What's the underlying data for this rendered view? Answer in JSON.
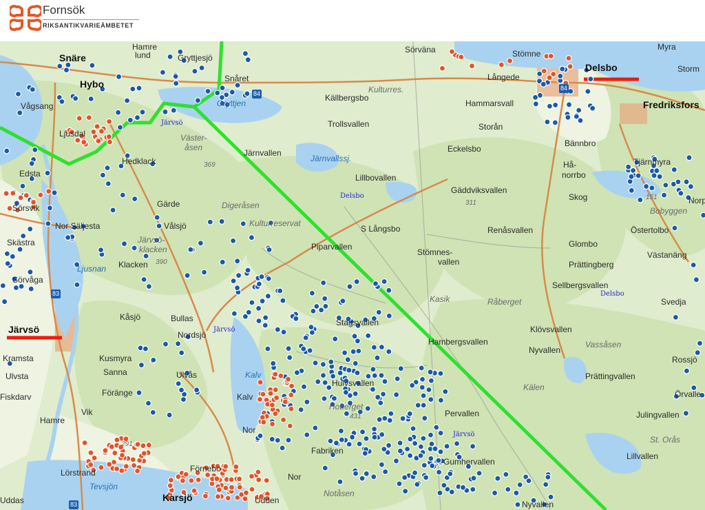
{
  "header": {
    "brand": "Fornsök",
    "subtitle": "RIKSANTIKVARIEÄMBETET",
    "logo_icon": "fornsok-cloverleaf-logo",
    "logo_color": "#e05a2a"
  },
  "colors": {
    "forest": "#cfe3b4",
    "open_land": "#eef3e2",
    "water": "#a9d2f0",
    "road": "#d88a4a",
    "route_line": "#2fe02f",
    "marker_blue": "#1b5aa6",
    "marker_orange": "#e0552a",
    "town": "#e7a77f",
    "highlight": "#ee1c0c"
  },
  "place_labels": [
    {
      "text": "Snäre",
      "cls": "big",
      "id": "snare"
    },
    {
      "text": "Hybo",
      "cls": "big",
      "id": "hybo"
    },
    {
      "text": "Gryttjesjö",
      "cls": "",
      "id": "gryttjesjo"
    },
    {
      "text": "Hamre",
      "cls": "",
      "id": "hamre-n"
    },
    {
      "text": "lund",
      "cls": "",
      "id": "lund"
    },
    {
      "text": "Snåret",
      "cls": "",
      "id": "snaret"
    },
    {
      "text": "Sörväna",
      "cls": "",
      "id": "sorvana"
    },
    {
      "text": "Stömne",
      "cls": "",
      "id": "stomne"
    },
    {
      "text": "Delsbo",
      "cls": "big",
      "id": "delsbo"
    },
    {
      "text": "Myra",
      "cls": "",
      "id": "myra"
    },
    {
      "text": "Storm",
      "cls": "",
      "id": "storm"
    },
    {
      "text": "Långede",
      "cls": "",
      "id": "langede"
    },
    {
      "text": "Fredriksfors",
      "cls": "big",
      "id": "fredriksfors"
    },
    {
      "text": "Vågsang",
      "cls": "",
      "id": "vagsang"
    },
    {
      "text": "Ljusdal",
      "cls": "",
      "id": "ljusdal"
    },
    {
      "text": "Gryttjen",
      "cls": "water",
      "id": "gryttjen"
    },
    {
      "text": "Kulturres.",
      "cls": "hill",
      "id": "kulturres"
    },
    {
      "text": "Källbergsbo",
      "cls": "",
      "id": "kallbergsbo"
    },
    {
      "text": "Hammarsvall",
      "cls": "",
      "id": "hammarsvall"
    },
    {
      "text": "Järvsö",
      "cls": "parish",
      "id": "parish-jarvso-1"
    },
    {
      "text": "Trollsvallen",
      "cls": "",
      "id": "trollsvallen"
    },
    {
      "text": "Storån",
      "cls": "",
      "id": "storan"
    },
    {
      "text": "Väster-",
      "cls": "hill",
      "id": "vaster1"
    },
    {
      "text": "åsen",
      "cls": "hill",
      "id": "vaster2"
    },
    {
      "text": "Järnvallen",
      "cls": "",
      "id": "jarnvallen"
    },
    {
      "text": "Eckelsbo",
      "cls": "",
      "id": "eckelsbo"
    },
    {
      "text": "Bännbro",
      "cls": "",
      "id": "bannbro"
    },
    {
      "text": "Hedklack",
      "cls": "",
      "id": "hedklack"
    },
    {
      "text": "369",
      "cls": "num",
      "id": "n369"
    },
    {
      "text": "Järnvallssj.",
      "cls": "water",
      "id": "jarnvallssj"
    },
    {
      "text": "Hå-",
      "cls": "",
      "id": "hak1"
    },
    {
      "text": "norrbo",
      "cls": "",
      "id": "hak2"
    },
    {
      "text": "Tjärnmyra",
      "cls": "",
      "id": "tjarnmyra"
    },
    {
      "text": "Lillbovallen",
      "cls": "",
      "id": "lillbovallen"
    },
    {
      "text": "Edsta",
      "cls": "",
      "id": "edsta"
    },
    {
      "text": "Gäddviksvallen",
      "cls": "",
      "id": "gaddviksvallen"
    },
    {
      "text": "Skog",
      "cls": "",
      "id": "skog"
    },
    {
      "text": "151",
      "cls": "num",
      "id": "n151"
    },
    {
      "text": "311",
      "cls": "num",
      "id": "n311"
    },
    {
      "text": "Delsbo",
      "cls": "parish",
      "id": "parish-delsbo-1"
    },
    {
      "text": "Bobyggen",
      "cls": "hill",
      "id": "bobyggen"
    },
    {
      "text": "Norp",
      "cls": "",
      "id": "norp"
    },
    {
      "text": "Sörsvik",
      "cls": "",
      "id": "sorsvik"
    },
    {
      "text": "Gärde",
      "cls": "",
      "id": "garde"
    },
    {
      "text": "Digeråsen",
      "cls": "hill",
      "id": "digerasen"
    },
    {
      "text": "Kulturreservat",
      "cls": "hill",
      "id": "kulturreservat"
    },
    {
      "text": "Östertolbo",
      "cls": "",
      "id": "ostertolbo"
    },
    {
      "text": "Nor Säljesta",
      "cls": "",
      "id": "saljesta"
    },
    {
      "text": "Vålsjö",
      "cls": "",
      "id": "valsjo"
    },
    {
      "text": "S Långsbo",
      "cls": "",
      "id": "slangsbo"
    },
    {
      "text": "Renåsvallen",
      "cls": "",
      "id": "renasvallen"
    },
    {
      "text": "Skästra",
      "cls": "",
      "id": "skastra"
    },
    {
      "text": "Järvsö-",
      "cls": "hill",
      "id": "jarvsok1"
    },
    {
      "text": "klacken",
      "cls": "hill",
      "id": "jarvsok2"
    },
    {
      "text": "Glombo",
      "cls": "",
      "id": "glombo"
    },
    {
      "text": "Västanäng",
      "cls": "",
      "id": "vastanang"
    },
    {
      "text": "390",
      "cls": "num",
      "id": "n390"
    },
    {
      "text": "Piparvallen",
      "cls": "",
      "id": "piparvallen"
    },
    {
      "text": "Stömnes-",
      "cls": "",
      "id": "stomnes1"
    },
    {
      "text": "vallen",
      "cls": "",
      "id": "stomnes2"
    },
    {
      "text": "Prättingberg",
      "cls": "",
      "id": "prattingberg"
    },
    {
      "text": "Sörvåga",
      "cls": "",
      "id": "sorvaga"
    },
    {
      "text": "Klacken",
      "cls": "",
      "id": "klacken"
    },
    {
      "text": "Ljusnan",
      "cls": "water",
      "id": "ljusnan"
    },
    {
      "text": "Sellbergsvallen",
      "cls": "",
      "id": "sellbergsvallen"
    },
    {
      "text": "Svedja",
      "cls": "",
      "id": "svedja"
    },
    {
      "text": "Delsbo",
      "cls": "parish",
      "id": "parish-delsbo-2"
    },
    {
      "text": "Kasik",
      "cls": "hill",
      "id": "kasik"
    },
    {
      "text": "Råberget",
      "cls": "hill",
      "id": "raberget"
    },
    {
      "text": "Kåsjö",
      "cls": "",
      "id": "kasjo"
    },
    {
      "text": "Bullas",
      "cls": "",
      "id": "bullas"
    },
    {
      "text": "Järvsö",
      "cls": "big",
      "id": "jarvso"
    },
    {
      "text": "Stagsvallen",
      "cls": "",
      "id": "stagsvallen"
    },
    {
      "text": "Klövsvallen",
      "cls": "",
      "id": "klovsvallen"
    },
    {
      "text": "Nordsjö",
      "cls": "",
      "id": "nordsjo"
    },
    {
      "text": "Järvsö",
      "cls": "parish",
      "id": "parish-jarvso-2"
    },
    {
      "text": "Hambergsvallen",
      "cls": "",
      "id": "hambergsvallen"
    },
    {
      "text": "Kramsta",
      "cls": "",
      "id": "kramsta"
    },
    {
      "text": "Kusmyra",
      "cls": "",
      "id": "kusmyra"
    },
    {
      "text": "Nyvallen",
      "cls": "",
      "id": "nyvallen"
    },
    {
      "text": "Vassåsen",
      "cls": "hill",
      "id": "vassasen"
    },
    {
      "text": "Rossjö",
      "cls": "",
      "id": "rossjo"
    },
    {
      "text": "Ulvsta",
      "cls": "",
      "id": "ulvsta"
    },
    {
      "text": "Sanna",
      "cls": "",
      "id": "sanna"
    },
    {
      "text": "Ulvås",
      "cls": "",
      "id": "ulvas"
    },
    {
      "text": "Kalv",
      "cls": "water",
      "id": "kalv"
    },
    {
      "text": "Hulvsvallen",
      "cls": "",
      "id": "hulvsvallen"
    },
    {
      "text": "Prättingvallen",
      "cls": "",
      "id": "prattingvallen"
    },
    {
      "text": "Kälen",
      "cls": "hill",
      "id": "kalen"
    },
    {
      "text": "Fiskdarv",
      "cls": "",
      "id": "fiskdarv"
    },
    {
      "text": "Förängе",
      "cls": "",
      "id": "forange"
    },
    {
      "text": "Kalv",
      "cls": "",
      "id": "kalv2"
    },
    {
      "text": "Hoberget",
      "cls": "hill",
      "id": "hoberget"
    },
    {
      "text": "Örvalle",
      "cls": "",
      "id": "orvalle"
    },
    {
      "text": "Vik",
      "cls": "",
      "id": "vik"
    },
    {
      "text": "Julingvallen",
      "cls": "",
      "id": "julingvallen"
    },
    {
      "text": "431",
      "cls": "num",
      "id": "n431"
    },
    {
      "text": "Pervallen",
      "cls": "",
      "id": "pervallen"
    },
    {
      "text": "Hamre",
      "cls": "",
      "id": "hamre"
    },
    {
      "text": "Nor",
      "cls": "",
      "id": "nor1"
    },
    {
      "text": "Järvsö",
      "cls": "parish",
      "id": "parish-jarvso-3"
    },
    {
      "text": "St. Orås",
      "cls": "hill",
      "id": "storas"
    },
    {
      "text": "291",
      "cls": "num",
      "id": "n291"
    },
    {
      "text": "Fabriken",
      "cls": "",
      "id": "fabriken"
    },
    {
      "text": "Gumhervallen",
      "cls": "",
      "id": "gumhervallen"
    },
    {
      "text": "Lillvallen",
      "cls": "",
      "id": "lillvallen"
    },
    {
      "text": "Förnebo",
      "cls": "",
      "id": "fornebo"
    },
    {
      "text": "Lörstrand",
      "cls": "",
      "id": "lorstrand"
    },
    {
      "text": "Nor",
      "cls": "",
      "id": "nor2"
    },
    {
      "text": "Tevsjön",
      "cls": "water",
      "id": "tevsjon"
    },
    {
      "text": "Notåsen",
      "cls": "hill",
      "id": "notasen"
    },
    {
      "text": "Karsjö",
      "cls": "big",
      "id": "karsjo"
    },
    {
      "text": "Udden",
      "cls": "",
      "id": "udden"
    },
    {
      "text": "Uddas",
      "cls": "",
      "id": "uddas"
    },
    {
      "text": "Nyvallen",
      "cls": "",
      "id": "nyvallen2"
    }
  ],
  "road_shields": [
    "84",
    "84",
    "83",
    "83"
  ],
  "marker_icons": {
    "heritage_site": "heritage-site-marker-icon",
    "ancient_remain": "ancient-remain-marker-icon"
  }
}
